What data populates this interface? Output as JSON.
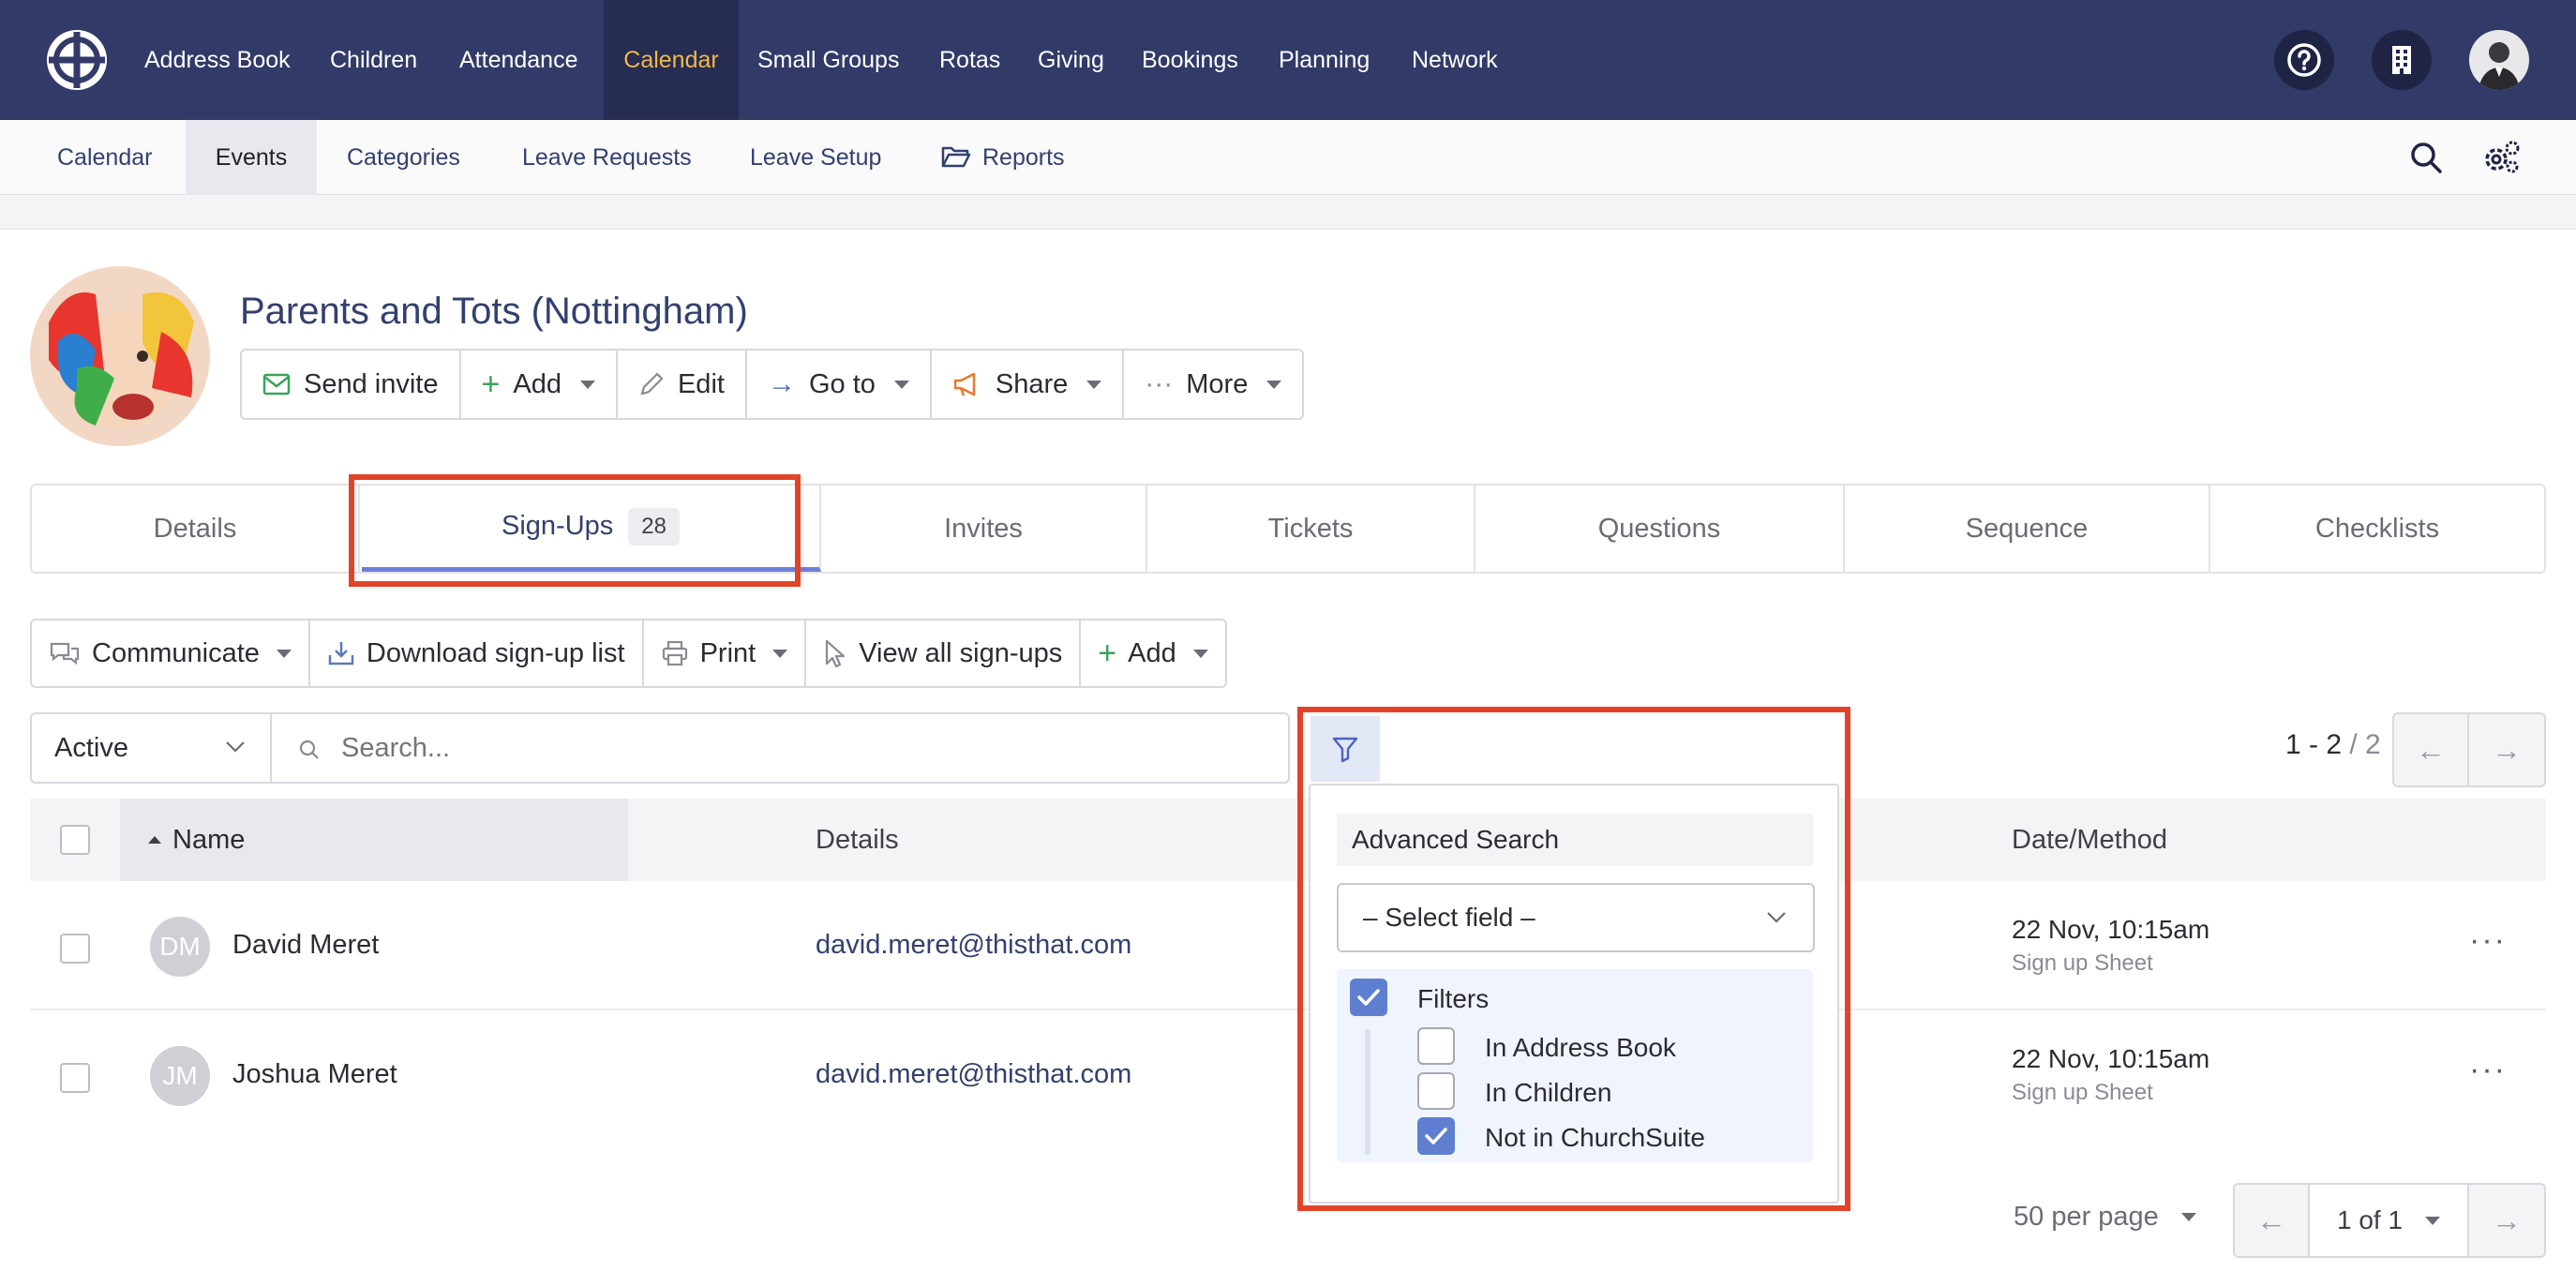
{
  "topnav": {
    "items": [
      "Address Book",
      "Children",
      "Attendance",
      "Calendar",
      "Small Groups",
      "Rotas",
      "Giving",
      "Bookings",
      "Planning",
      "Network"
    ],
    "active": "Calendar",
    "icons": [
      "help-icon",
      "building-icon",
      "user-avatar"
    ]
  },
  "subnav": {
    "items": [
      "Calendar",
      "Events",
      "Categories",
      "Leave Requests",
      "Leave Setup",
      "Reports"
    ],
    "active": "Events"
  },
  "event": {
    "title": "Parents and Tots (Nottingham)",
    "buttons": [
      "Send invite",
      "Add",
      "Edit",
      "Go to",
      "Share",
      "More"
    ]
  },
  "tabs": {
    "items": [
      "Details",
      "Sign-Ups",
      "Invites",
      "Tickets",
      "Questions",
      "Sequence",
      "Checklists"
    ],
    "active": "Sign-Ups",
    "signups_count": "28"
  },
  "actions": [
    "Communicate",
    "Download sign-up list",
    "Print",
    "View all sign-ups",
    "Add"
  ],
  "filter": {
    "status": "Active",
    "search_placeholder": "Search...",
    "range": "1 - 2",
    "total": "/ 2"
  },
  "advanced": {
    "heading": "Advanced Search",
    "select_field": "– Select field –",
    "filters_label": "Filters",
    "options": [
      {
        "label": "In Address Book",
        "checked": false
      },
      {
        "label": "In Children",
        "checked": false
      },
      {
        "label": "Not in ChurchSuite",
        "checked": true
      }
    ]
  },
  "table": {
    "headers": {
      "name": "Name",
      "details": "Details",
      "date": "Date/Method"
    },
    "rows": [
      {
        "initials": "DM",
        "name": "David Meret",
        "email": "david.meret@thisthat.com",
        "date": "22 Nov, 10:15am",
        "method": "Sign up Sheet"
      },
      {
        "initials": "JM",
        "name": "Joshua Meret",
        "email": "david.meret@thisthat.com",
        "date": "22 Nov, 10:15am",
        "method": "Sign up Sheet"
      }
    ]
  },
  "footer": {
    "per_page": "50 per page",
    "page": "1 of 1"
  },
  "colors": {
    "nav": "#323a68",
    "active_nav_text": "#f0b84a",
    "accent": "#6f7fd8",
    "highlight": "#e24328"
  }
}
